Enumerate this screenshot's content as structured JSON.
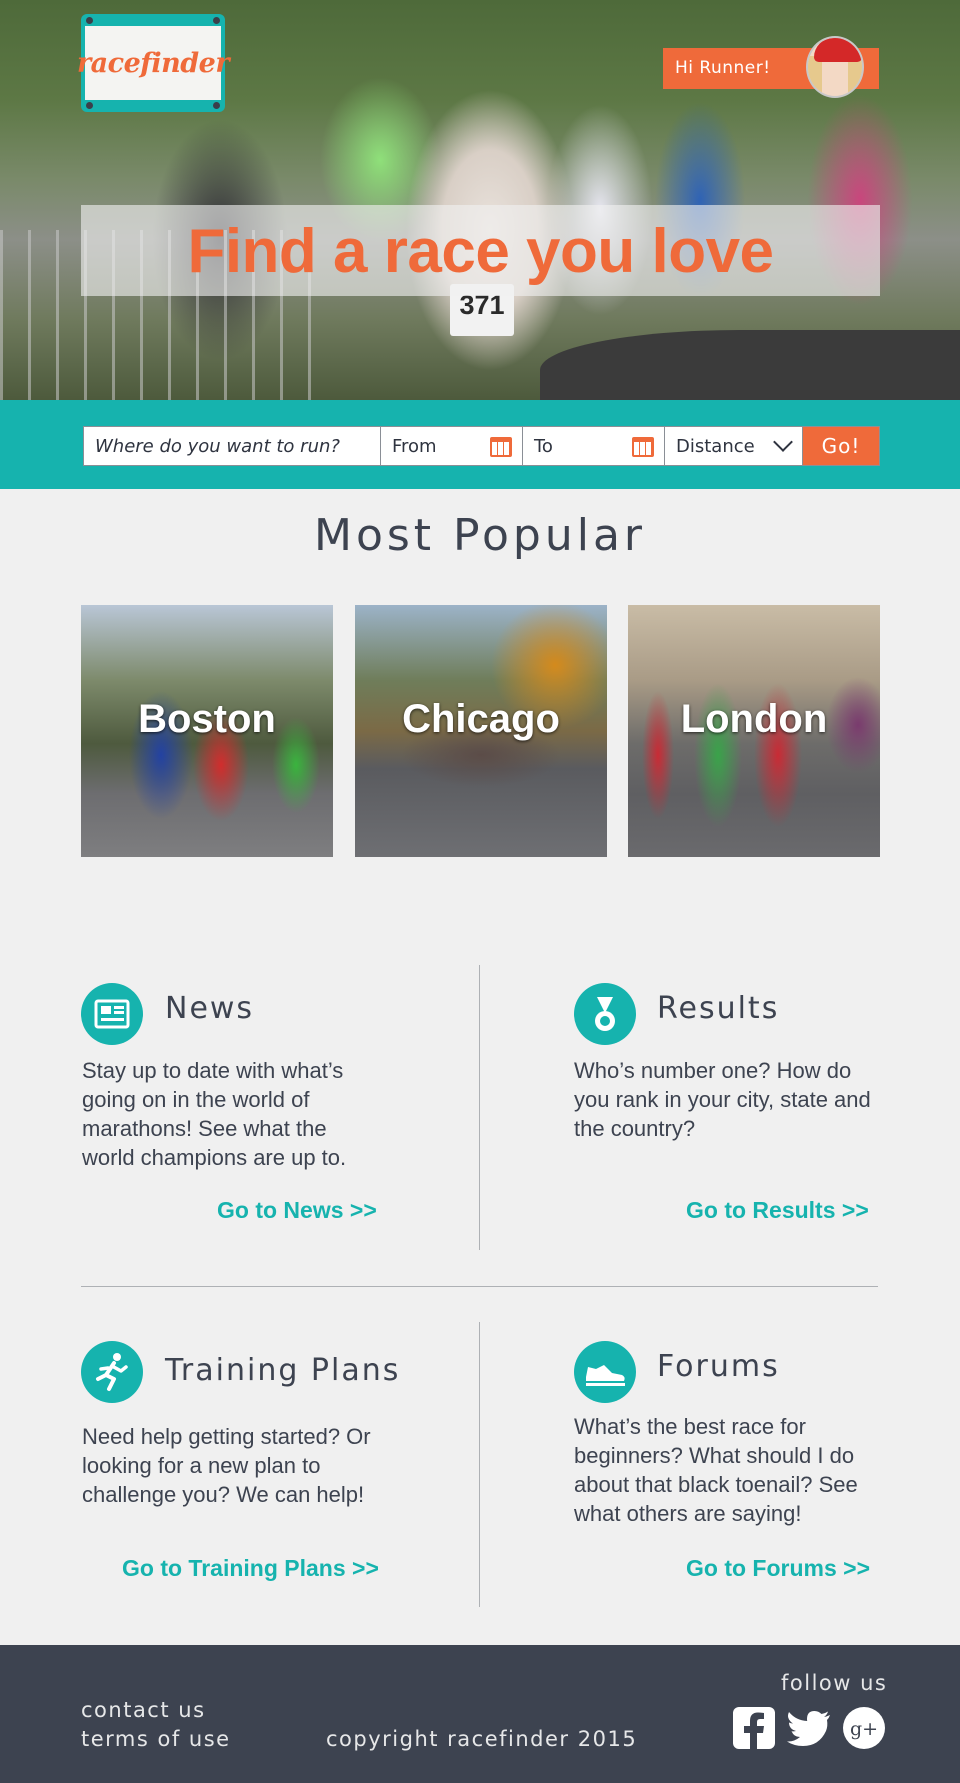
{
  "header": {
    "logo_text": "racefinder",
    "greeting": "Hi Runner!",
    "headline": "Find a race you love"
  },
  "hero": {
    "bib_number": "371"
  },
  "search": {
    "where_label": "Where do you want to run?",
    "from_label": "From",
    "to_label": "To",
    "distance_label": "Distance",
    "go_label": "Go!"
  },
  "popular": {
    "title": "Most Popular",
    "cities": [
      {
        "name": "Boston"
      },
      {
        "name": "Chicago"
      },
      {
        "name": "London"
      }
    ]
  },
  "sections": {
    "news": {
      "title": "News",
      "body": "Stay up to date with what’s going on in the world of marathons!  See what the world champions are up to.",
      "link": "Go to News >>"
    },
    "results": {
      "title": "Results",
      "body": "Who’s number one?  How do you rank in your city, state and the country?",
      "link": "Go to Results >>"
    },
    "training": {
      "title": "Training Plans",
      "body": "Need help getting started?  Or looking for a new plan to challenge you?  We can help!",
      "link": "Go to Training Plans >>"
    },
    "forums": {
      "title": "Forums",
      "body": "What’s the best race for beginners?  What should I do about that black toenail?  See what others are saying!",
      "link": "Go to Forums >>"
    }
  },
  "footer": {
    "contact": "contact us",
    "terms": "terms of use",
    "copyright": "copyright racefinder 2015",
    "follow": "follow us",
    "social": [
      {
        "icon": "facebook-icon"
      },
      {
        "icon": "twitter-icon"
      },
      {
        "icon": "google-plus-icon",
        "label": "g+"
      }
    ]
  },
  "colors": {
    "teal": "#16b3ae",
    "orange": "#ef6a3a",
    "slate": "#3d4350",
    "background": "#f0f0f0"
  }
}
